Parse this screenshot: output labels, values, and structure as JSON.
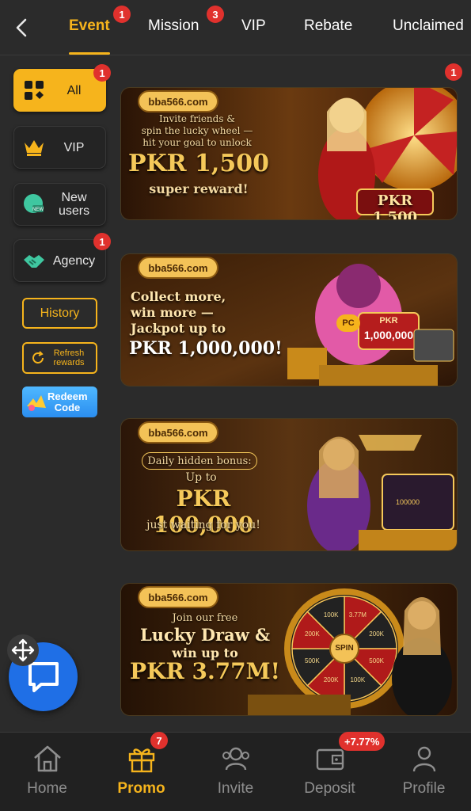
{
  "tabs": [
    {
      "label": "Event",
      "badge": "1",
      "active": true
    },
    {
      "label": "Mission",
      "badge": "3"
    },
    {
      "label": "VIP"
    },
    {
      "label": "Rebate"
    },
    {
      "label": "Unclaimed"
    }
  ],
  "sidebar": {
    "items": [
      {
        "label": "All",
        "badge": "1",
        "icon": "grid-icon",
        "active": true
      },
      {
        "label": "VIP",
        "icon": "crown-icon"
      },
      {
        "label": "New users",
        "icon": "new-user-icon"
      },
      {
        "label": "Agency",
        "badge": "1",
        "icon": "handshake-icon"
      }
    ],
    "history_label": "History",
    "refresh_label": "Refresh rewards",
    "redeem_label": "Redeem Code"
  },
  "banners": [
    {
      "badge": "1",
      "logo": "bba566.com",
      "lines": [
        "Invite friends &",
        "spin the lucky wheel —",
        "hit your goal to unlock"
      ],
      "amount": "PKR 1,500",
      "sub": "super reward!",
      "tag": "PKR 1,500"
    },
    {
      "logo": "bba566.com",
      "lines": [
        "Collect more,",
        "win more —",
        "Jackpot up to"
      ],
      "amount": "PKR 1,000,000!",
      "tag_top": "PKR",
      "tag": "1,000,000",
      "pc": "PC"
    },
    {
      "logo": "bba566.com",
      "lines": [
        "Daily hidden bonus:",
        "Up to"
      ],
      "amount": "PKR 100,000",
      "sub": "just waiting for you!",
      "tag": "100000"
    },
    {
      "logo": "bba566.com",
      "lines": [
        "Join our free",
        "Lucky Draw &",
        "win up to"
      ],
      "amount": "PKR 3.77M!",
      "wheel_center": "SPIN",
      "wheel_labels": [
        "3.77M",
        "200K",
        "500K",
        "100K",
        "200K",
        "500K",
        "200K",
        "100K"
      ]
    }
  ],
  "bottom_nav": [
    {
      "label": "Home",
      "icon": "home-icon"
    },
    {
      "label": "Promo",
      "icon": "gift-icon",
      "badge": "7",
      "active": true
    },
    {
      "label": "Invite",
      "icon": "invite-icon"
    },
    {
      "label": "Deposit",
      "icon": "wallet-icon",
      "badge": "+7.77%"
    },
    {
      "label": "Profile",
      "icon": "profile-icon"
    }
  ],
  "colors": {
    "accent": "#f6b41c",
    "badge": "#e0312d",
    "bg": "#2b2b2b",
    "chat": "#1f6fe6"
  }
}
